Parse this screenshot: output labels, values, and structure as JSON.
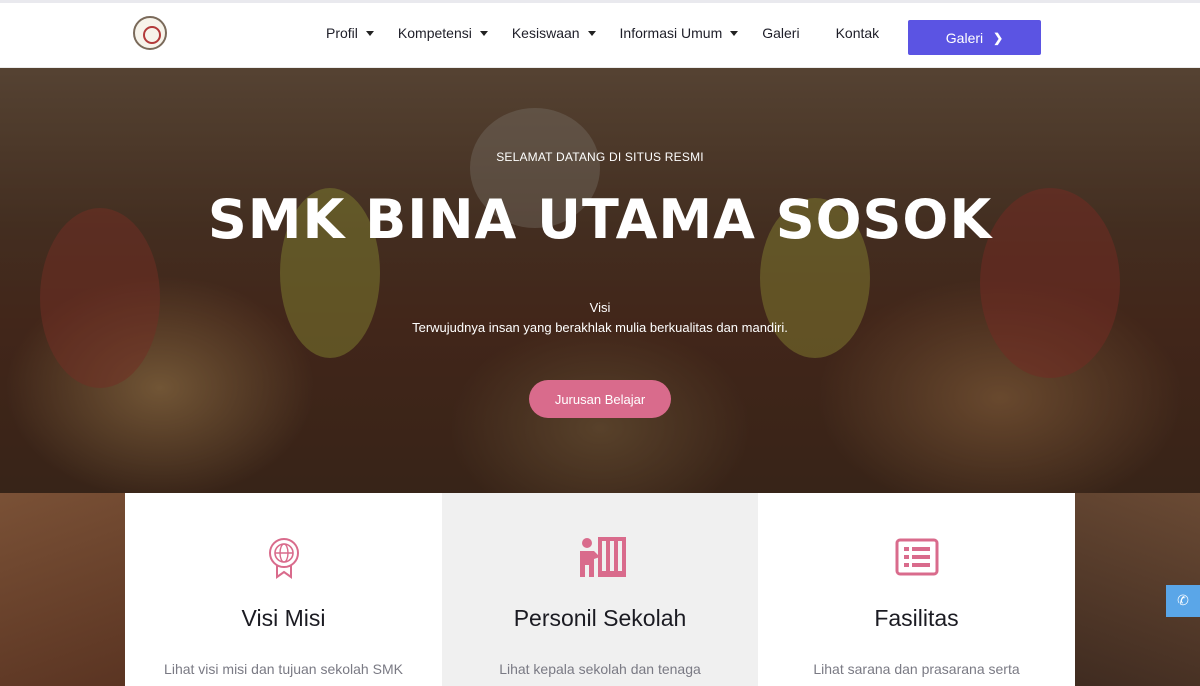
{
  "nav": {
    "menu": [
      {
        "label": "Profil",
        "dropdown": true
      },
      {
        "label": "Kompetensi",
        "dropdown": true
      },
      {
        "label": "Kesiswaan",
        "dropdown": true
      },
      {
        "label": "Informasi Umum",
        "dropdown": true
      },
      {
        "label": "Galeri",
        "dropdown": false
      },
      {
        "label": "Kontak",
        "dropdown": false
      }
    ],
    "cta_label": "Galeri"
  },
  "hero": {
    "subtitle": "SELAMAT DATANG DI SITUS RESMI",
    "title": "SMK BINA UTAMA SOSOK",
    "visi_label": "Visi",
    "visi_text": "Terwujudnya insan yang berakhlak mulia berkualitas dan mandiri.",
    "button_label": "Jurusan Belajar"
  },
  "features": [
    {
      "title": "Visi Misi",
      "text_line1": "Lihat visi misi dan tujuan sekolah SMK",
      "icon": "certificate-globe-icon"
    },
    {
      "title": "Personil Sekolah",
      "text_line1": "Lihat kepala sekolah dan tenaga",
      "icon": "teacher-board-icon"
    },
    {
      "title": "Fasilitas",
      "text_line1": "Lihat sarana dan prasarana serta",
      "icon": "list-icon"
    }
  ],
  "colors": {
    "accent": "#5b54e3",
    "pink": "#d96b8c",
    "phone": "#5aa6e8"
  }
}
